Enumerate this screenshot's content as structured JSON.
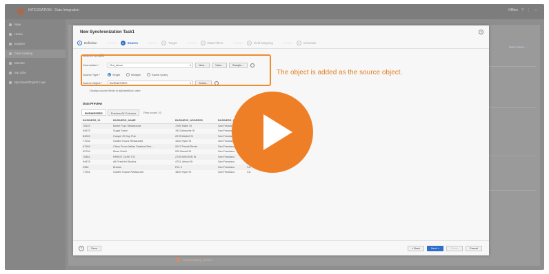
{
  "app": {
    "title": "INTEGRATION · Data Integration",
    "right_items": [
      "Offline",
      "?",
      "⋮",
      "—"
    ]
  },
  "sidebar": {
    "items": [
      {
        "label": "New"
      },
      {
        "label": "Home"
      },
      {
        "label": "Explore"
      },
      {
        "label": "Data Catalog"
      },
      {
        "label": "Monitor"
      },
      {
        "label": "My Jobs"
      },
      {
        "label": "My Import/Export Logs"
      }
    ]
  },
  "background": {
    "right_link": "New Conn...",
    "footer_item": "MySQLMysql_Orders"
  },
  "dialog": {
    "title": "New Synchronization Task1",
    "help_icon": "?",
    "steps": [
      {
        "num": "1",
        "label": "Definition",
        "state": "done"
      },
      {
        "num": "2",
        "label": "Source",
        "state": "active"
      },
      {
        "num": "3",
        "label": "Target",
        "state": "todo"
      },
      {
        "num": "4",
        "label": "Data Filters",
        "state": "todo"
      },
      {
        "num": "5",
        "label": "Field Mapping",
        "state": "todo"
      },
      {
        "num": "6",
        "label": "Schedule",
        "state": "todo"
      }
    ],
    "source_details": {
      "section_label": "Source Details",
      "connection": {
        "label": "Connection:*",
        "value": "Ora_demo",
        "buttons": [
          "New...",
          "View...",
          "Sample..."
        ]
      },
      "source_type": {
        "label": "Source Type:*",
        "options": [
          "Single",
          "Multiple",
          "Saved Query"
        ],
        "selected": "Single"
      },
      "source_object": {
        "label": "Source Object:*",
        "value": "BUSINESSES",
        "button": "Select..."
      },
      "hint": "Display source fields in alphabetical order"
    },
    "data_preview": {
      "section_label": "Data Preview",
      "tabs": [
        {
          "label": "BUSINESSES"
        },
        {
          "label": "Preview All Columns"
        }
      ],
      "count_text": "Row count: 10",
      "columns": [
        "BUSINESS_ID",
        "BUSINESS_NAME",
        "BUSINESS_ADDRESS",
        "BUSINESS_CITY",
        "BUSINESS_STATE"
      ],
      "rows": [
        [
          "78149",
          "Barrel Fuzz Steakhouse",
          "7265 Talkin St",
          "San Francisco",
          "CA"
        ],
        [
          "94575",
          "Sugar Sushi",
          "193 Delmonte St",
          "San Francisco",
          "CA"
        ],
        [
          "84059",
          "Cooper El Guy Pub",
          "2078 Market St",
          "San Francisco",
          "CA"
        ],
        [
          "77234",
          "Golden Hours Restaurant",
          "1040 Hyde St",
          "San Francisco",
          "CA"
        ],
        [
          "47069",
          "Citrus Pouro Italian Seafood Res...",
          "2047 Powell Street",
          "San Francisco",
          "CA"
        ],
        [
          "92704",
          "Moss Sushi",
          "209 Broadl St",
          "San Francisco",
          "CA"
        ],
        [
          "76381",
          "PARKIT CAFE ITG",
          "2735 MISSION St",
          "San Francisco",
          "CA"
        ],
        [
          "94478",
          "All Fired Art Studios",
          "4701 Jetson St",
          "San Francisco",
          "CA"
        ],
        [
          "2364",
          "Brooks",
          "Pier 4",
          "San Francisco",
          "CA"
        ],
        [
          "77254",
          "Golden House Restaurant",
          "1840 Hyde St",
          "San Francisco",
          "CA"
        ]
      ]
    },
    "footer": {
      "help": "?",
      "save": "Save",
      "buttons": [
        {
          "label": "< Back",
          "kind": "normal"
        },
        {
          "label": "Next >",
          "kind": "primary"
        },
        {
          "label": "Finish",
          "kind": "disabled"
        },
        {
          "label": "Cancel",
          "kind": "normal"
        }
      ]
    }
  },
  "annotation": {
    "text": "The object is added as the source object.",
    "color": "#e27f24"
  },
  "overlay": {
    "play_icon": "play-icon",
    "color": "#ef7f27"
  }
}
